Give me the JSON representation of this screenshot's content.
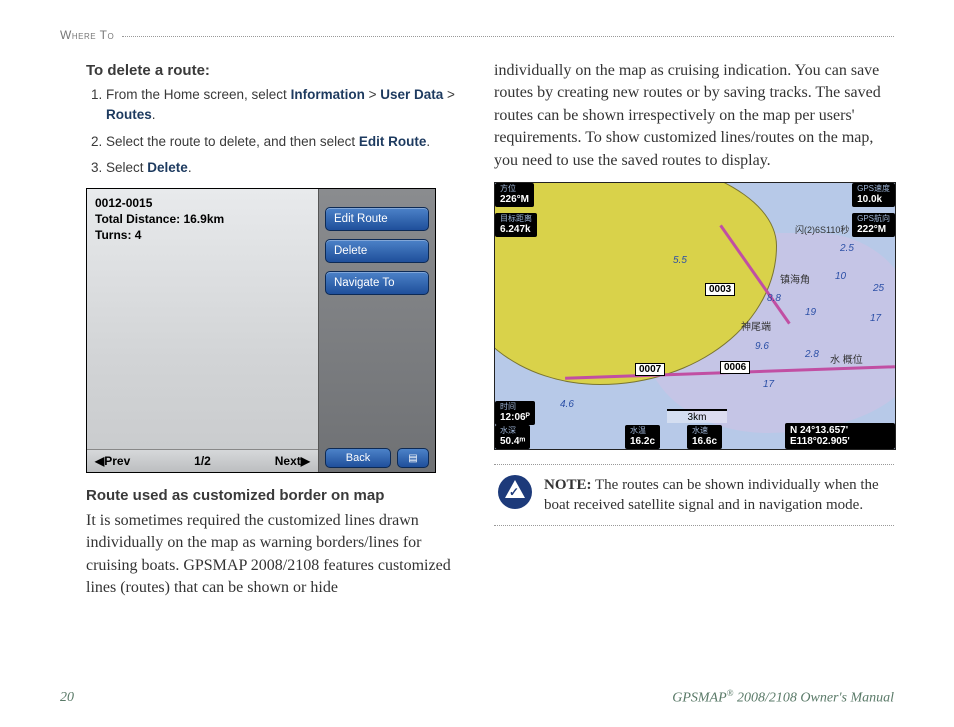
{
  "header": {
    "section": "Where To"
  },
  "left_col": {
    "delete_heading": "To delete a route:",
    "steps": [
      {
        "pre": "From the Home screen, select ",
        "t1": "Information",
        "sep1": " > ",
        "t2": "User Data",
        "sep2": " > ",
        "t3": "Routes",
        "post": "."
      },
      {
        "pre": "Select the route to delete, and then select ",
        "t1": "Edit Route",
        "post": "."
      },
      {
        "pre": "Select ",
        "t1": "Delete",
        "post": "."
      }
    ],
    "border_heading": "Route used as customized border on map",
    "border_para": "It is sometimes required the customized lines drawn individually on the map as warning borders/lines for cruising boats. GPSMAP 2008/2108 features customized lines (routes) that can be shown or hide"
  },
  "right_col": {
    "continuation": "individually on the map as cruising indication. You can save routes by creating new routes or by saving tracks. The saved routes can be shown irrespectively on the map per users' requirements. To show customized lines/routes on the map, you need to use the saved routes to display.",
    "note_label": "NOTE:",
    "note_body": " The routes can be shown individually when the boat received satellite signal and in navigation mode."
  },
  "device_left": {
    "route_id": "0012-0015",
    "total_distance": "Total Distance: 16.9km",
    "turns": "Turns: 4",
    "prev": "◀Prev",
    "page": "1/2",
    "next": "Next▶",
    "btn_edit": "Edit Route",
    "btn_delete": "Delete",
    "btn_navigate": "Navigate To",
    "btn_back": "Back",
    "menu_icon": "▤"
  },
  "device_right": {
    "heading_label": "方位",
    "heading_val": "226°M",
    "dest_dist_label": "目标距离",
    "dest_dist_val": "6.247k",
    "gps_speed_label": "GPS速度",
    "gps_speed_val": "10.0k",
    "gps_hdg_label": "GPS航向",
    "gps_hdg_val": "222°M",
    "time_label": "时间",
    "time_val": "12:06ᴾ",
    "depth_label": "水深",
    "depth_val": "50.4ᵐ",
    "wtemp_label": "水温",
    "wtemp_val": "16.2c",
    "wspeed_label": "水速",
    "wspeed_val": "16.6c",
    "pos_lat": "N  24°13.657'",
    "pos_lon": "E118°02.905'",
    "wp_0003": "0003",
    "wp_0006": "0006",
    "wp_0007": "0007",
    "scale": "3km",
    "place_zhenhai": "镇海角",
    "place_shenwei": "神尾端",
    "place_water": "水 概位",
    "label_26s110": "闪(2)6S110秒",
    "d25": "2.5",
    "d10": "10",
    "d25b": "25",
    "d55": "5.5",
    "d88": "8.8",
    "d19": "19",
    "d17": "17",
    "d17b": "17",
    "d96": "9.6",
    "d28": "2.8",
    "d46": "4.6"
  },
  "footer": {
    "page_number": "20",
    "product": "GPSMAP",
    "reg": "®",
    "model": " 2008/2108  Owner's Manual"
  }
}
